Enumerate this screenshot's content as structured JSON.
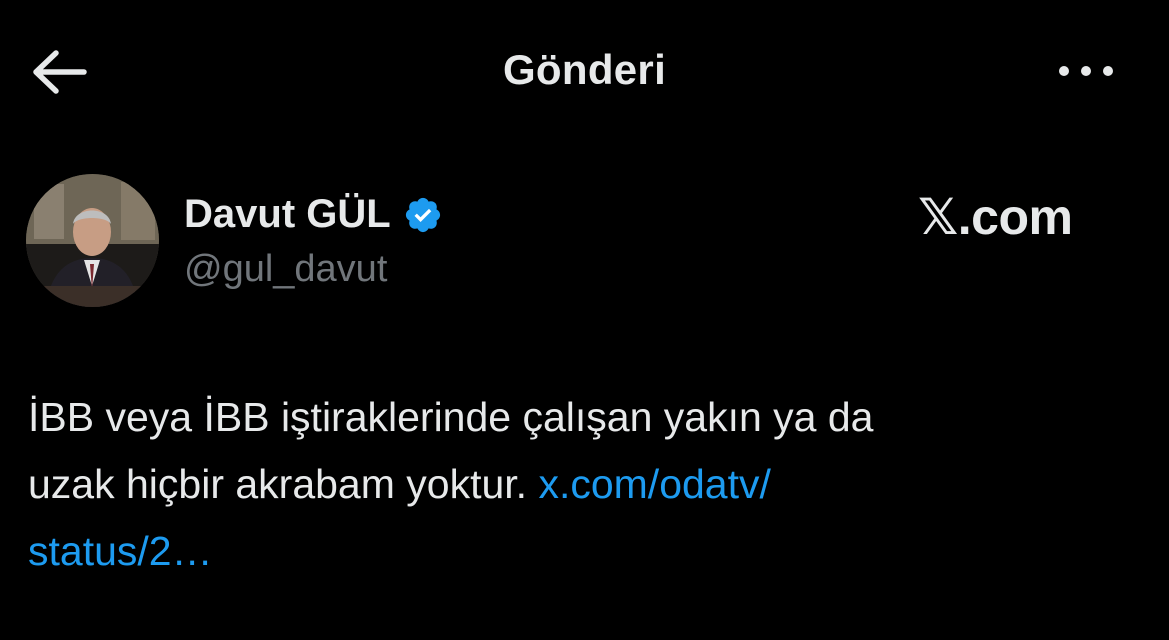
{
  "header": {
    "title": "Gönderi",
    "back_icon": "arrow-left-icon",
    "more_icon": "more-horizontal-icon"
  },
  "author": {
    "name": "Davut GÜL",
    "handle": "@gul_davut",
    "verified_icon": "verified-badge-icon",
    "verified_color": "#1d9bf0"
  },
  "watermark": "𝕏.com",
  "tweet": {
    "line1": "İBB veya İBB iştiraklerinde çalışan yakın ya da",
    "line2_text": "uzak hiçbir akrabam yoktur. ",
    "link_part1": "x.com/odatv/",
    "link_part2": "status/2…"
  },
  "colors": {
    "background": "#000000",
    "text": "#e7e9ea",
    "secondary": "#71767b",
    "link": "#1d9bf0"
  }
}
